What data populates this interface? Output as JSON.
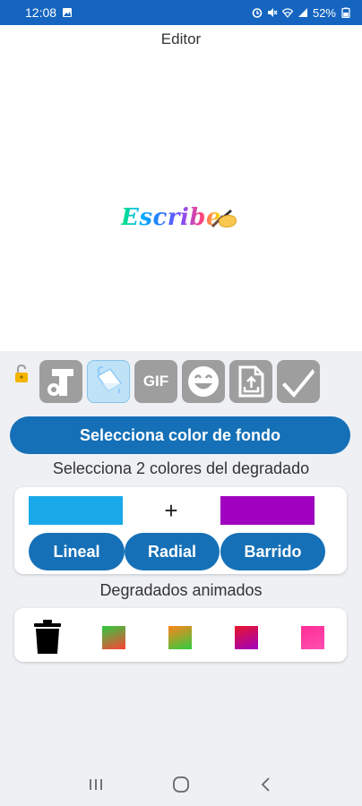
{
  "status_bar": {
    "time": "12:08",
    "battery": "52%"
  },
  "editor": {
    "title": "Editor",
    "preview_text": "Escribe"
  },
  "toolbar": {
    "tools": [
      {
        "name": "text-settings",
        "icon": "text-settings-icon"
      },
      {
        "name": "paint-bucket",
        "icon": "paint-bucket-icon",
        "active": true
      },
      {
        "name": "gif",
        "label": "GIF"
      },
      {
        "name": "emoji",
        "icon": "smiley-icon"
      },
      {
        "name": "export",
        "icon": "file-export-icon"
      },
      {
        "name": "confirm",
        "icon": "checkmark-icon"
      }
    ]
  },
  "background": {
    "select_button": "Selecciona color de fondo",
    "gradient_label": "Selecciona 2 colores del degradado",
    "color1": "#1aa9e8",
    "color2": "#a000c0",
    "plus": "+",
    "buttons": {
      "linear": "Lineal",
      "radial": "Radial",
      "sweep": "Barrido"
    },
    "animated_label": "Degradados animados",
    "animated_swatches": [
      {
        "from": "#2ecc40",
        "to": "#ff4136"
      },
      {
        "from": "#ff851b",
        "to": "#2ecc40"
      },
      {
        "from": "#e8162a",
        "to": "#a000c0"
      },
      {
        "from": "#ff2d95",
        "to": "#ff4fb0"
      }
    ]
  },
  "colors": {
    "accent": "#1570b7",
    "status_bar": "#1565c0",
    "panel_bg": "#eef0f4"
  }
}
